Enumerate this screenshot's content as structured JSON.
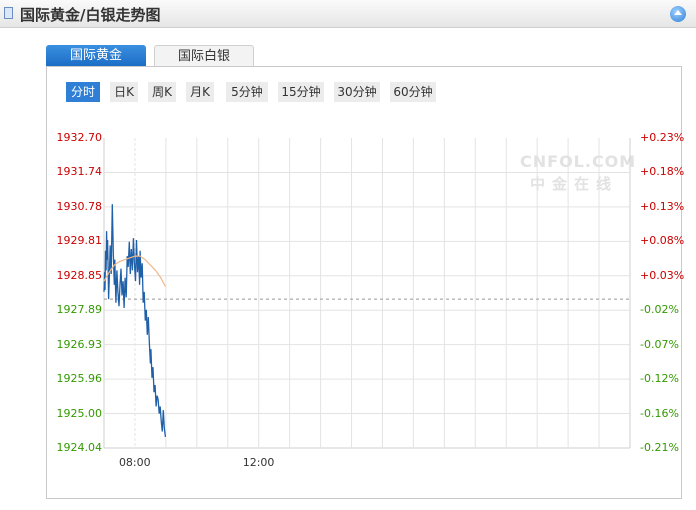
{
  "header": {
    "title": "国际黄金/白银走势图"
  },
  "tabs": [
    {
      "label": "国际黄金",
      "active": true
    },
    {
      "label": "国际白银",
      "active": false
    }
  ],
  "periods": [
    {
      "label": "分时",
      "active": true
    },
    {
      "label": "日K"
    },
    {
      "label": "周K"
    },
    {
      "label": "月K"
    },
    {
      "label": "5分钟"
    },
    {
      "label": "15分钟"
    },
    {
      "label": "30分钟"
    },
    {
      "label": "60分钟"
    }
  ],
  "watermark": {
    "line1": "CNFOL.COM",
    "line2": "中金在线"
  },
  "colors": {
    "up": "#cc0000",
    "down": "#339900",
    "price_line": "#2060a8",
    "avg_line": "#f0b88a",
    "active": "#2f7fd6"
  },
  "chart_data": {
    "type": "line",
    "title": "",
    "y_ticks": [
      "1932.70",
      "1931.74",
      "1930.78",
      "1929.81",
      "1928.85",
      "1927.89",
      "1926.93",
      "1925.96",
      "1925.00",
      "1924.04"
    ],
    "y_pct_ticks": [
      "+0.23%",
      "+0.18%",
      "+0.13%",
      "+0.08%",
      "+0.03%",
      "-0.02%",
      "-0.07%",
      "-0.12%",
      "-0.16%",
      "-0.21%"
    ],
    "ylim": [
      1924.04,
      1932.7
    ],
    "reference_price": 1928.2,
    "x_ticks": [
      "08:00",
      "12:00"
    ],
    "x_range_minutes": [
      420,
      1440
    ],
    "x_tick_minutes": [
      480,
      720
    ],
    "grid": true,
    "series": [
      {
        "role": "price",
        "x": [
          420,
          421,
          422,
          423,
          424,
          425,
          426,
          427,
          428,
          429,
          430,
          432,
          434,
          436,
          438,
          440,
          441,
          443,
          445,
          447,
          449,
          451,
          453,
          455,
          457,
          459,
          461,
          463,
          465,
          467,
          469,
          471,
          473,
          475,
          477,
          479,
          481,
          483,
          485,
          487,
          489,
          490,
          492,
          494,
          496,
          498,
          500,
          502,
          504,
          506,
          508,
          510,
          511,
          513,
          515,
          517,
          519,
          521,
          523,
          525,
          527,
          529,
          531,
          533,
          535,
          537,
          539
        ],
        "y": [
          1928.4,
          1928.95,
          1928.45,
          1929.55,
          1929.0,
          1930.1,
          1929.3,
          1929.85,
          1929.1,
          1928.2,
          1928.7,
          1929.7,
          1928.9,
          1930.85,
          1929.5,
          1928.6,
          1929.3,
          1928.1,
          1929.0,
          1928.4,
          1928.0,
          1928.6,
          1929.05,
          1928.3,
          1928.7,
          1927.95,
          1928.8,
          1928.25,
          1929.4,
          1929.1,
          1929.8,
          1928.9,
          1929.6,
          1929.0,
          1929.9,
          1929.2,
          1928.7,
          1929.85,
          1928.95,
          1929.4,
          1928.6,
          1929.55,
          1928.8,
          1929.2,
          1928.1,
          1928.4,
          1927.6,
          1927.9,
          1927.2,
          1927.7,
          1926.95,
          1926.4,
          1926.8,
          1926.0,
          1926.3,
          1925.6,
          1925.8,
          1925.2,
          1925.5,
          1925.4,
          1925.0,
          1925.2,
          1924.8,
          1924.5,
          1925.1,
          1924.6,
          1924.35
        ]
      },
      {
        "role": "average",
        "x": [
          420,
          430,
          440,
          450,
          460,
          470,
          480,
          490,
          500,
          510,
          520,
          530,
          539
        ],
        "y": [
          1928.7,
          1928.95,
          1929.15,
          1929.25,
          1929.3,
          1929.35,
          1929.4,
          1929.4,
          1929.3,
          1929.15,
          1929.0,
          1928.8,
          1928.55
        ]
      }
    ]
  }
}
